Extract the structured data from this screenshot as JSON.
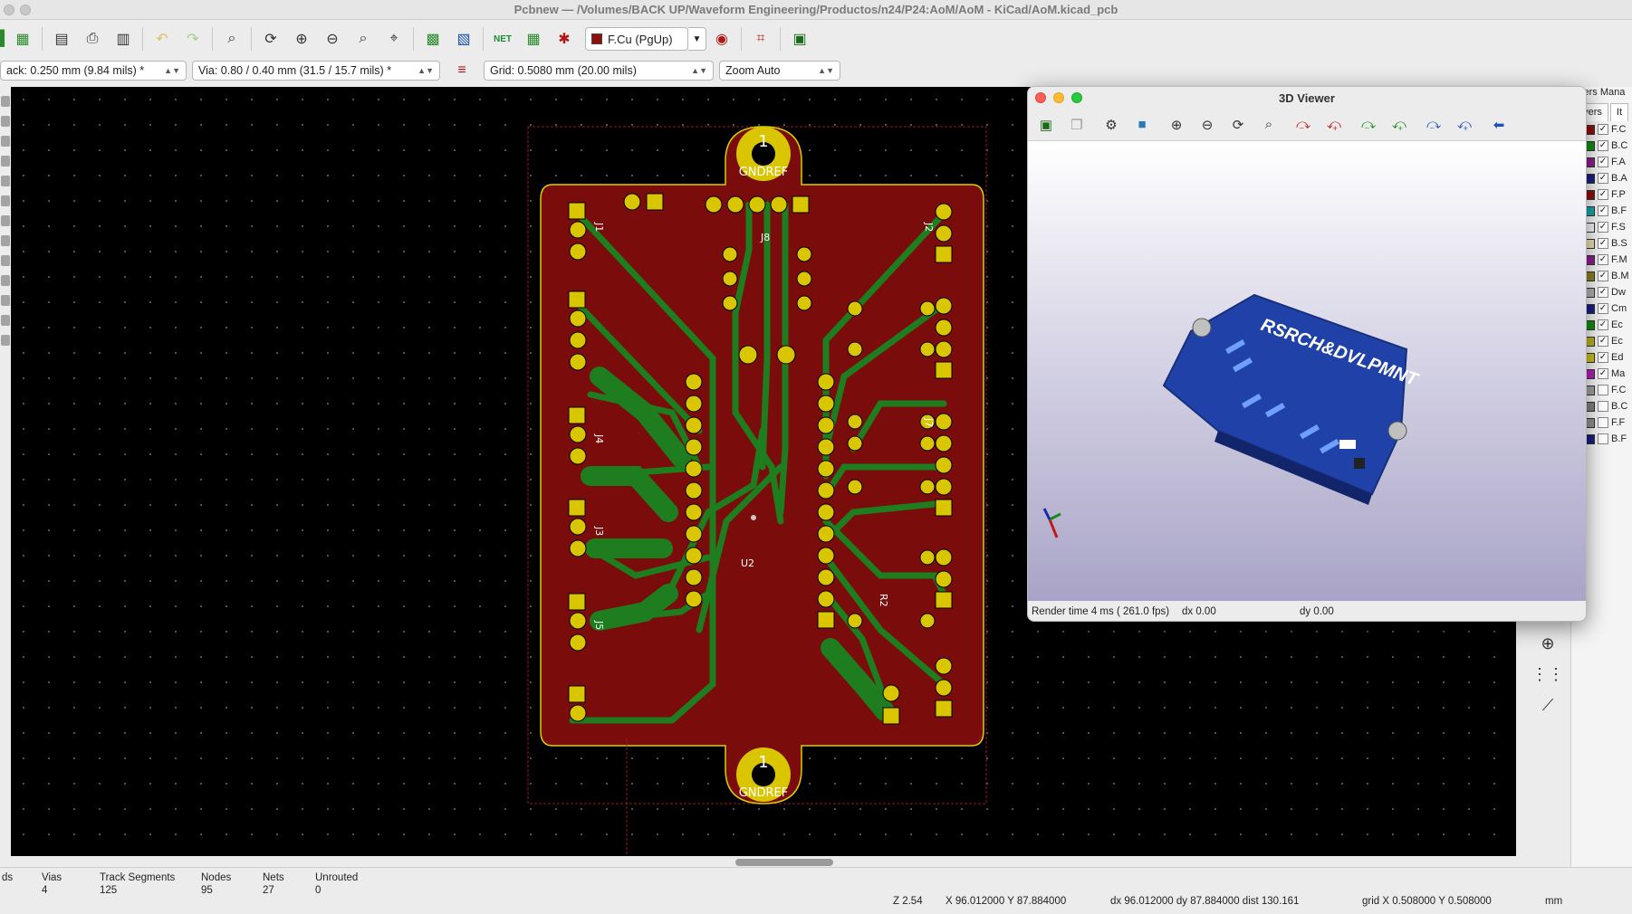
{
  "window": {
    "title": "Pcbnew — /Volumes/BACK UP/Waveform Engineering/Productos/n24/P24:AoM/AoM - KiCad/AoM.kicad_pcb"
  },
  "toolbar": {
    "layer_select": "F.Cu (PgUp)",
    "layer_color": "#8b1010"
  },
  "toolbar2": {
    "track_width": "ack: 0.250 mm (9.84 mils) *",
    "via_size": "Via: 0.80 / 0.40 mm (31.5 / 15.7 mils) *",
    "grid": "Grid: 0.5080 mm (20.00 mils)",
    "zoom": "Zoom Auto"
  },
  "pcb": {
    "board_color": "#7a0c0c",
    "copper_trace_color": "#1e7d1e",
    "pad_color": "#d9c600",
    "board_text": [
      "GNDREF",
      "GNDREF"
    ],
    "pad_number": [
      "1",
      "1"
    ],
    "ref_labels": [
      "J8",
      "J1",
      "J4",
      "J3",
      "J5",
      "J2",
      "J7",
      "U2",
      "R2"
    ]
  },
  "viewer3d": {
    "title": "3D Viewer",
    "board_silkscreen": "RSRCH&DVLPMNT",
    "render_time": "Render time 4 ms ( 261.0 fps)",
    "dx": "dx 0.00",
    "dy": "dy 0.00"
  },
  "layers_panel": {
    "title": "yers Mana",
    "tabs": [
      "ayers",
      "It"
    ],
    "layers": [
      {
        "name": "F.C",
        "color": "#8b1010",
        "checked": true
      },
      {
        "name": "B.C",
        "color": "#138a13",
        "checked": true
      },
      {
        "name": "F.A",
        "color": "#8a1f8a",
        "checked": true
      },
      {
        "name": "B.A",
        "color": "#1a1f80",
        "checked": true
      },
      {
        "name": "F.P",
        "color": "#8b1010",
        "checked": true
      },
      {
        "name": "B.F",
        "color": "#17a5a5",
        "checked": true
      },
      {
        "name": "F.S",
        "color": "#f4f4f4",
        "checked": true
      },
      {
        "name": "B.S",
        "color": "#e8e0b0",
        "checked": true
      },
      {
        "name": "F.M",
        "color": "#8a1f8a",
        "checked": true
      },
      {
        "name": "B.M",
        "color": "#8a7f20",
        "checked": true
      },
      {
        "name": "Dw",
        "color": "#b0b0b0",
        "checked": true
      },
      {
        "name": "Cm",
        "color": "#1a1f80",
        "checked": true
      },
      {
        "name": "Ec",
        "color": "#138a13",
        "checked": true
      },
      {
        "name": "Ec",
        "color": "#b8b020",
        "checked": true
      },
      {
        "name": "Ed",
        "color": "#c8c020",
        "checked": true
      },
      {
        "name": "Ma",
        "color": "#b020b0",
        "checked": true
      },
      {
        "name": "F.C",
        "color": "#a0a0a0",
        "checked": false
      },
      {
        "name": "B.C",
        "color": "#808080",
        "checked": false
      },
      {
        "name": "F.F",
        "color": "#909090",
        "checked": false
      },
      {
        "name": "B.F",
        "color": "#1a1f80",
        "checked": false
      }
    ]
  },
  "status": {
    "items": [
      {
        "label": "ds",
        "value": ""
      },
      {
        "label": "Vias",
        "value": "4"
      },
      {
        "label": "Track Segments",
        "value": "125"
      },
      {
        "label": "Nodes",
        "value": "95"
      },
      {
        "label": "Nets",
        "value": "27"
      },
      {
        "label": "Unrouted",
        "value": "0"
      }
    ],
    "zoom": "Z 2.54",
    "xy": "X 96.012000  Y 87.884000",
    "dxdy": "dx 96.012000  dy 87.884000  dist 130.161",
    "grid": "grid X 0.508000  Y 0.508000",
    "units": "mm"
  }
}
